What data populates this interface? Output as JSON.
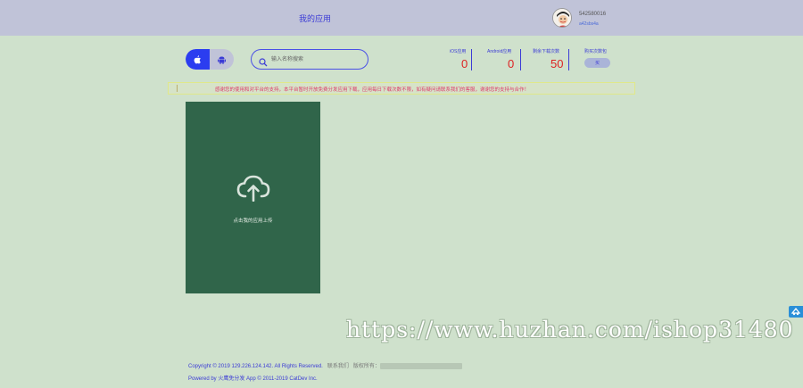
{
  "header": {
    "title": "我的应用",
    "user_id": "542580016",
    "user_sub": "a42sbs4a"
  },
  "toolbar": {
    "platforms": [
      "ios",
      "android"
    ],
    "search_placeholder": "输入名称搜索"
  },
  "stats": [
    {
      "label": "iOS应用",
      "value": "0"
    },
    {
      "label": "Android应用",
      "value": "0"
    },
    {
      "label": "剩余下载次数",
      "value": "50"
    },
    {
      "label": "购买次数包",
      "button": "买"
    }
  ],
  "notice": "感谢您的使用和对平台的支持，本平台暂时开放免费分发应用下载，应用每日下载次数不限，如有疑问请联系我们的客服，谢谢您的支持与合作！",
  "upload": {
    "label": "点击我的应用上传"
  },
  "watermark": "https://www.huzhan.com/ishop31480",
  "footer": {
    "copyright": "Copyright © 2019 129.226.124.142. All Rights Reserved.",
    "contact": "联系我们",
    "rights_prefix": "版权所有：",
    "powered": "Powered by 火鹰免分发 App © 2011-2019 CatDev Inc."
  },
  "colors": {
    "background": "#cfe1cc",
    "topbar": "#c0c3d8",
    "accent": "#2b3df0",
    "upload_card": "#30654a",
    "stat_value": "#dd2222",
    "notice_text": "#e0386a"
  }
}
